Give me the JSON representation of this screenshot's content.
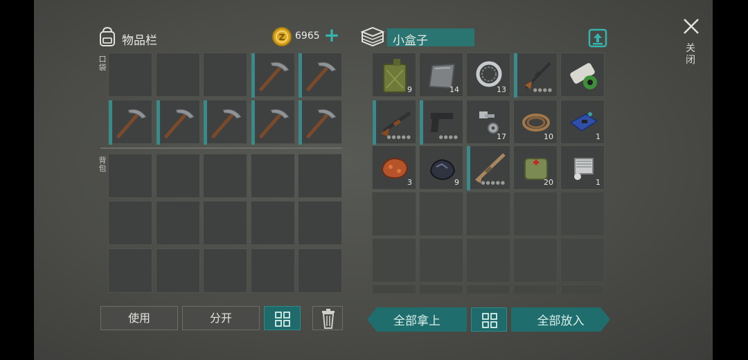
{
  "left_panel": {
    "title": "物品栏",
    "pocket_label": "口袋",
    "backpack_label": "背包",
    "coins": "6965",
    "add_symbol": "+"
  },
  "right_panel": {
    "container_name": "小盒子"
  },
  "pocket_items": [
    {
      "icon": "empty"
    },
    {
      "icon": "empty"
    },
    {
      "icon": "empty"
    },
    {
      "icon": "pickaxe-icon"
    },
    {
      "icon": "pickaxe-icon"
    },
    {
      "icon": "pickaxe-icon"
    },
    {
      "icon": "pickaxe-icon"
    },
    {
      "icon": "pickaxe-icon"
    },
    {
      "icon": "pickaxe-icon"
    },
    {
      "icon": "pickaxe-icon"
    }
  ],
  "box_items": [
    {
      "icon": "jerrycan-icon",
      "count": "9"
    },
    {
      "icon": "metal-plate-icon",
      "count": "14"
    },
    {
      "icon": "bearing-ring-icon",
      "count": "13"
    },
    {
      "icon": "rifle-icon",
      "count": "",
      "dots": "●●●●"
    },
    {
      "icon": "toxic-spray-can-icon",
      "count": ""
    },
    {
      "icon": "shotgun-icon",
      "count": "",
      "dots": "●●●●●"
    },
    {
      "icon": "pistol-icon",
      "count": "",
      "dots": "●●●●"
    },
    {
      "icon": "bolt-nut-icon",
      "count": "17"
    },
    {
      "icon": "rope-icon",
      "count": "10"
    },
    {
      "icon": "circuit-board-icon",
      "count": "1"
    },
    {
      "icon": "copper-ore-icon",
      "count": "3"
    },
    {
      "icon": "coal-ore-icon",
      "count": "9"
    },
    {
      "icon": "assault-rifle-icon",
      "count": "",
      "dots": "●●●●●"
    },
    {
      "icon": "medkit-bag-icon",
      "count": "20"
    },
    {
      "icon": "engine-part-icon",
      "count": "1"
    }
  ],
  "buttons": {
    "use": "使用",
    "split": "分开",
    "take_all": "全部拿上",
    "put_all": "全部放入"
  },
  "close_label": "关闭",
  "colors": {
    "accent_teal": "#1f6d6c",
    "durability_bar": "#3a8a8a",
    "coin_gold": "#d9a521"
  }
}
